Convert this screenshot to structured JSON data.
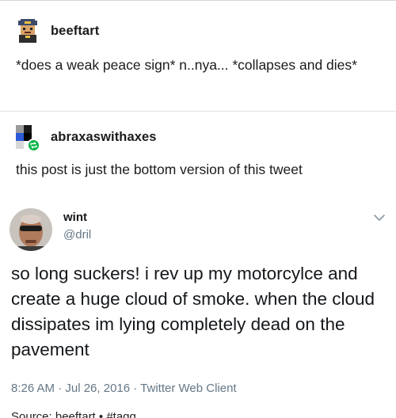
{
  "post_one": {
    "username": "beeftart",
    "body": "*does a weak peace sign* n..nya... *collapses and dies*"
  },
  "post_two": {
    "username": "abraxaswithaxes",
    "body": "this post is just the bottom version of this tweet"
  },
  "tweet": {
    "display_name": "wint",
    "handle": "@dril",
    "text": "so long suckers! i rev up my motorcylce and create a huge cloud of smoke. when the cloud dissipates im lying completely dead on the pavement",
    "meta": "8:26 AM · Jul 26, 2016 · Twitter Web Client",
    "cutoff_text": "Source: beeftart • #tagg"
  },
  "icons": {
    "reblog": "reblog-icon",
    "chevron": "chevron-down-icon"
  },
  "colors": {
    "reblog_green": "#00b341",
    "twitter_gray": "#657786"
  }
}
